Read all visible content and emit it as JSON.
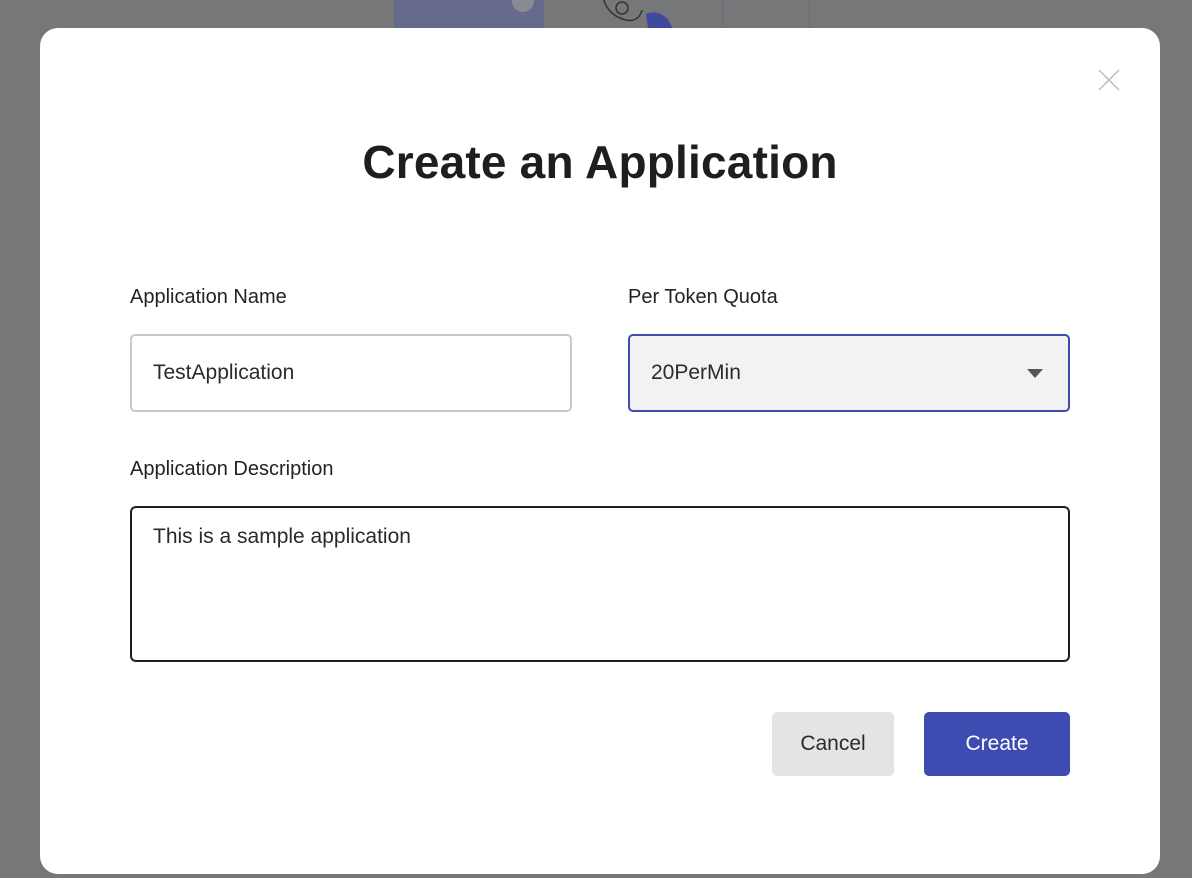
{
  "modal": {
    "title": "Create an Application",
    "close_icon": "close-icon"
  },
  "form": {
    "name": {
      "label": "Application Name",
      "value": "TestApplication"
    },
    "quota": {
      "label": "Per Token Quota",
      "selected": "20PerMin",
      "icon": "chevron-down-icon"
    },
    "description": {
      "label": "Application Description",
      "value": "This is a sample application"
    }
  },
  "actions": {
    "cancel_label": "Cancel",
    "create_label": "Create"
  },
  "colors": {
    "accent": "#3e4bb0",
    "backdrop": "#767779",
    "cancel_bg": "#e4e4e5"
  }
}
